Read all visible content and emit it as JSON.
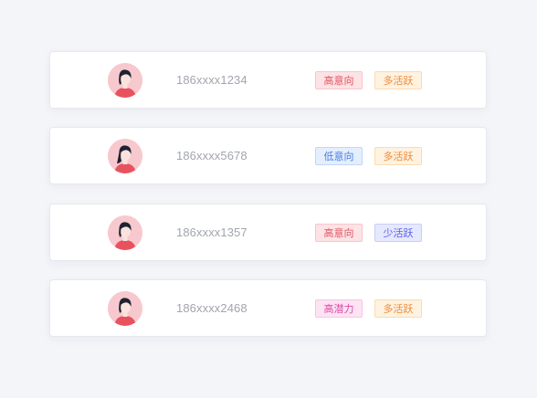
{
  "colors": {
    "page_background": "#f4f5f9",
    "card_background": "#ffffff",
    "phone_text": "#a2a5ae"
  },
  "tag_styles": {
    "red": {
      "bg": "#fde3e5",
      "border": "#f7c6cb",
      "color": "#e0535f"
    },
    "orange": {
      "bg": "#fef2e1",
      "border": "#fbdcb0",
      "color": "#f08b3a"
    },
    "blue": {
      "bg": "#e4eefd",
      "border": "#c3d7f8",
      "color": "#4a7fe0"
    },
    "indigo": {
      "bg": "#e6e8fd",
      "border": "#c9cdf8",
      "color": "#5b63e6"
    },
    "pink": {
      "bg": "#fde3f3",
      "border": "#f8c5e5",
      "color": "#d94aa6"
    }
  },
  "users": [
    {
      "avatar_icon": "user-avatar-icon",
      "phone": "186xxxx1234",
      "tags": [
        {
          "label": "高意向",
          "style": "red"
        },
        {
          "label": "多活跃",
          "style": "orange"
        }
      ]
    },
    {
      "avatar_icon": "user-avatar-icon",
      "phone": "186xxxx5678",
      "tags": [
        {
          "label": "低意向",
          "style": "blue"
        },
        {
          "label": "多活跃",
          "style": "orange"
        }
      ]
    },
    {
      "avatar_icon": "user-avatar-icon",
      "phone": "186xxxx1357",
      "tags": [
        {
          "label": "高意向",
          "style": "red"
        },
        {
          "label": "少活跃",
          "style": "indigo"
        }
      ]
    },
    {
      "avatar_icon": "user-avatar-icon",
      "phone": "186xxxx2468",
      "tags": [
        {
          "label": "高潜力",
          "style": "pink"
        },
        {
          "label": "多活跃",
          "style": "orange"
        }
      ]
    }
  ]
}
